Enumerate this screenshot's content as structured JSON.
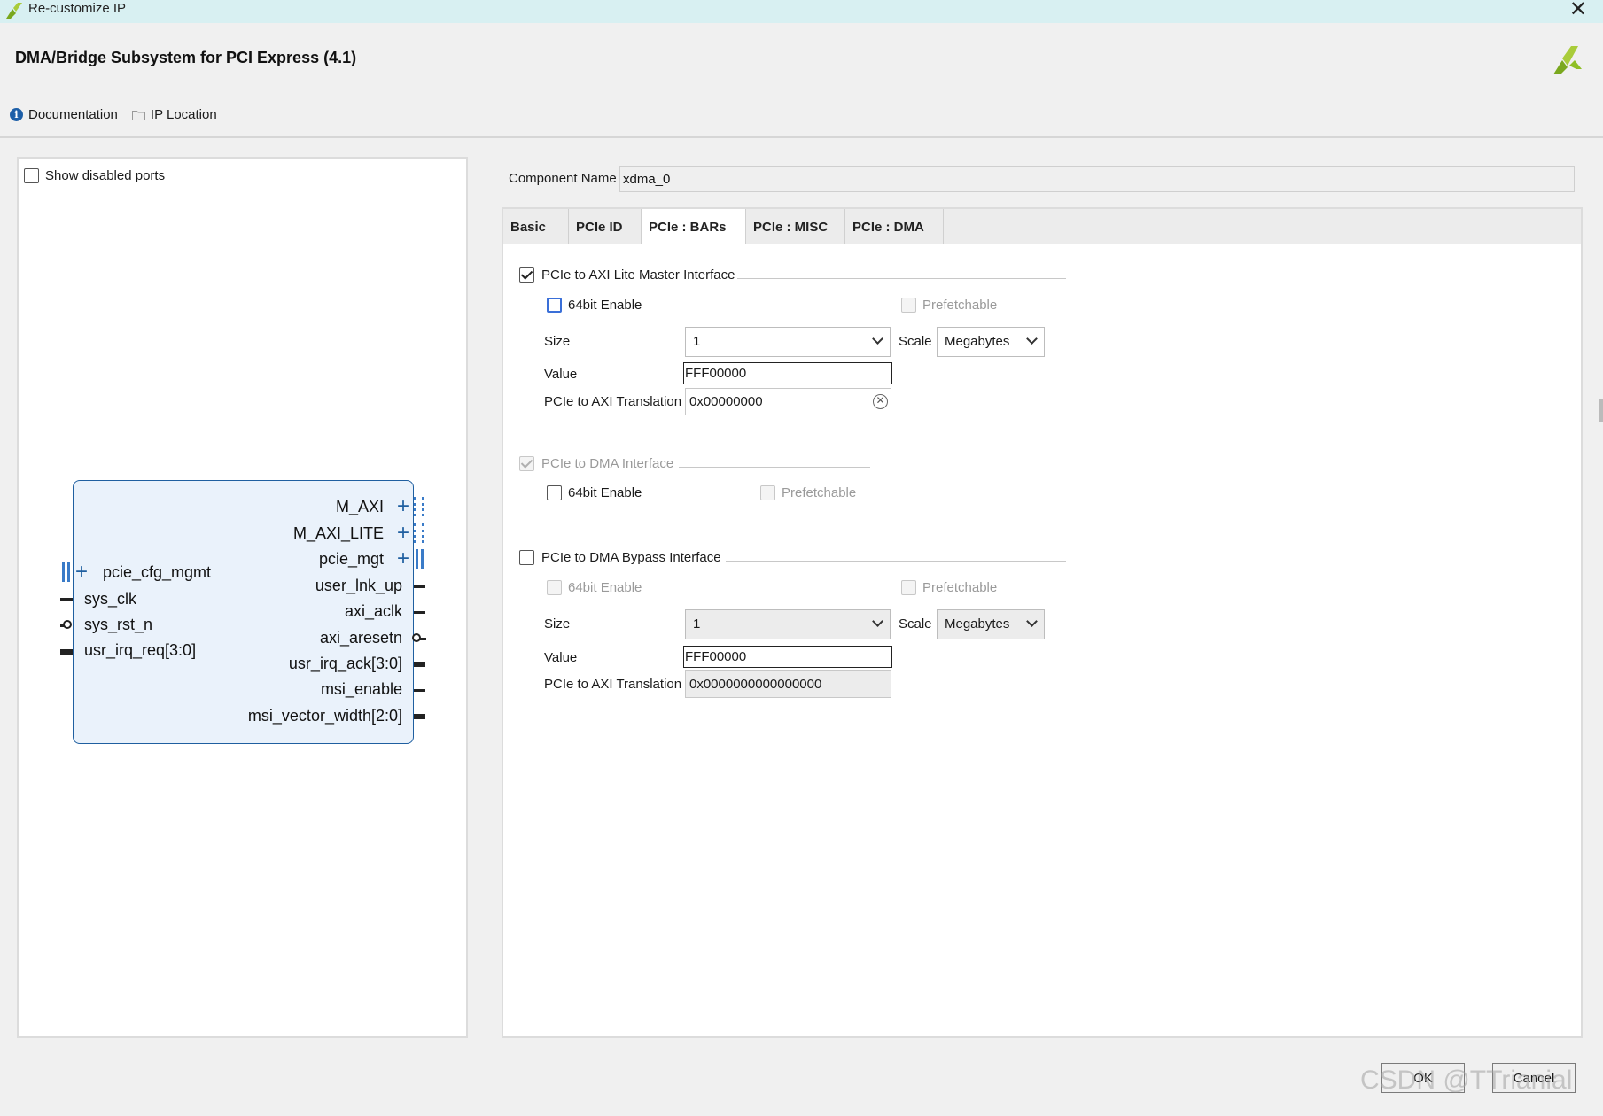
{
  "window": {
    "title": "Re-customize IP",
    "close_glyph": "✕"
  },
  "header": {
    "title": "DMA/Bridge Subsystem for PCI Express (4.1)",
    "logo_icon": "xilinx-logo-icon",
    "brand_color": "#8fbf26"
  },
  "doc_bar": {
    "documentation": "Documentation",
    "ip_location": "IP Location"
  },
  "left_panel": {
    "show_disabled_ports": "Show disabled ports",
    "left_ports": [
      "pcie_cfg_mgmt",
      "sys_clk",
      "sys_rst_n",
      "usr_irq_req[3:0]"
    ],
    "right_ports": [
      "M_AXI",
      "M_AXI_LITE",
      "pcie_mgt",
      "user_lnk_up",
      "axi_aclk",
      "axi_aresetn",
      "usr_irq_ack[3:0]",
      "msi_enable",
      "msi_vector_width[2:0]"
    ]
  },
  "component": {
    "label": "Component Name",
    "value": "xdma_0"
  },
  "tabs": [
    "Basic",
    "PCIe ID",
    "PCIe : BARs",
    "PCIe : MISC",
    "PCIe : DMA"
  ],
  "active_tab": "PCIe : BARs",
  "axi_lite": {
    "title": "PCIe to AXI Lite Master Interface",
    "enable64": "64bit Enable",
    "prefetchable": "Prefetchable",
    "size_label": "Size",
    "size_value": "1",
    "scale_label": "Scale",
    "scale_value": "Megabytes",
    "value_label": "Value",
    "value": "FFF00000",
    "translation_label": "PCIe to AXI Translation",
    "translation_value": "0x00000000",
    "clear_glyph": "✕"
  },
  "dma": {
    "title": "PCIe to DMA Interface",
    "enable64": "64bit Enable",
    "prefetchable": "Prefetchable"
  },
  "bypass": {
    "title": "PCIe to DMA Bypass Interface",
    "enable64": "64bit Enable",
    "prefetchable": "Prefetchable",
    "size_label": "Size",
    "size_value": "1",
    "scale_label": "Scale",
    "scale_value": "Megabytes",
    "value_label": "Value",
    "value": "FFF00000",
    "translation_label": "PCIe to AXI Translation",
    "translation_value": "0x0000000000000000"
  },
  "buttons": {
    "ok": "OK",
    "cancel": "Cancel"
  },
  "watermark": "CSDN @TTrianial"
}
